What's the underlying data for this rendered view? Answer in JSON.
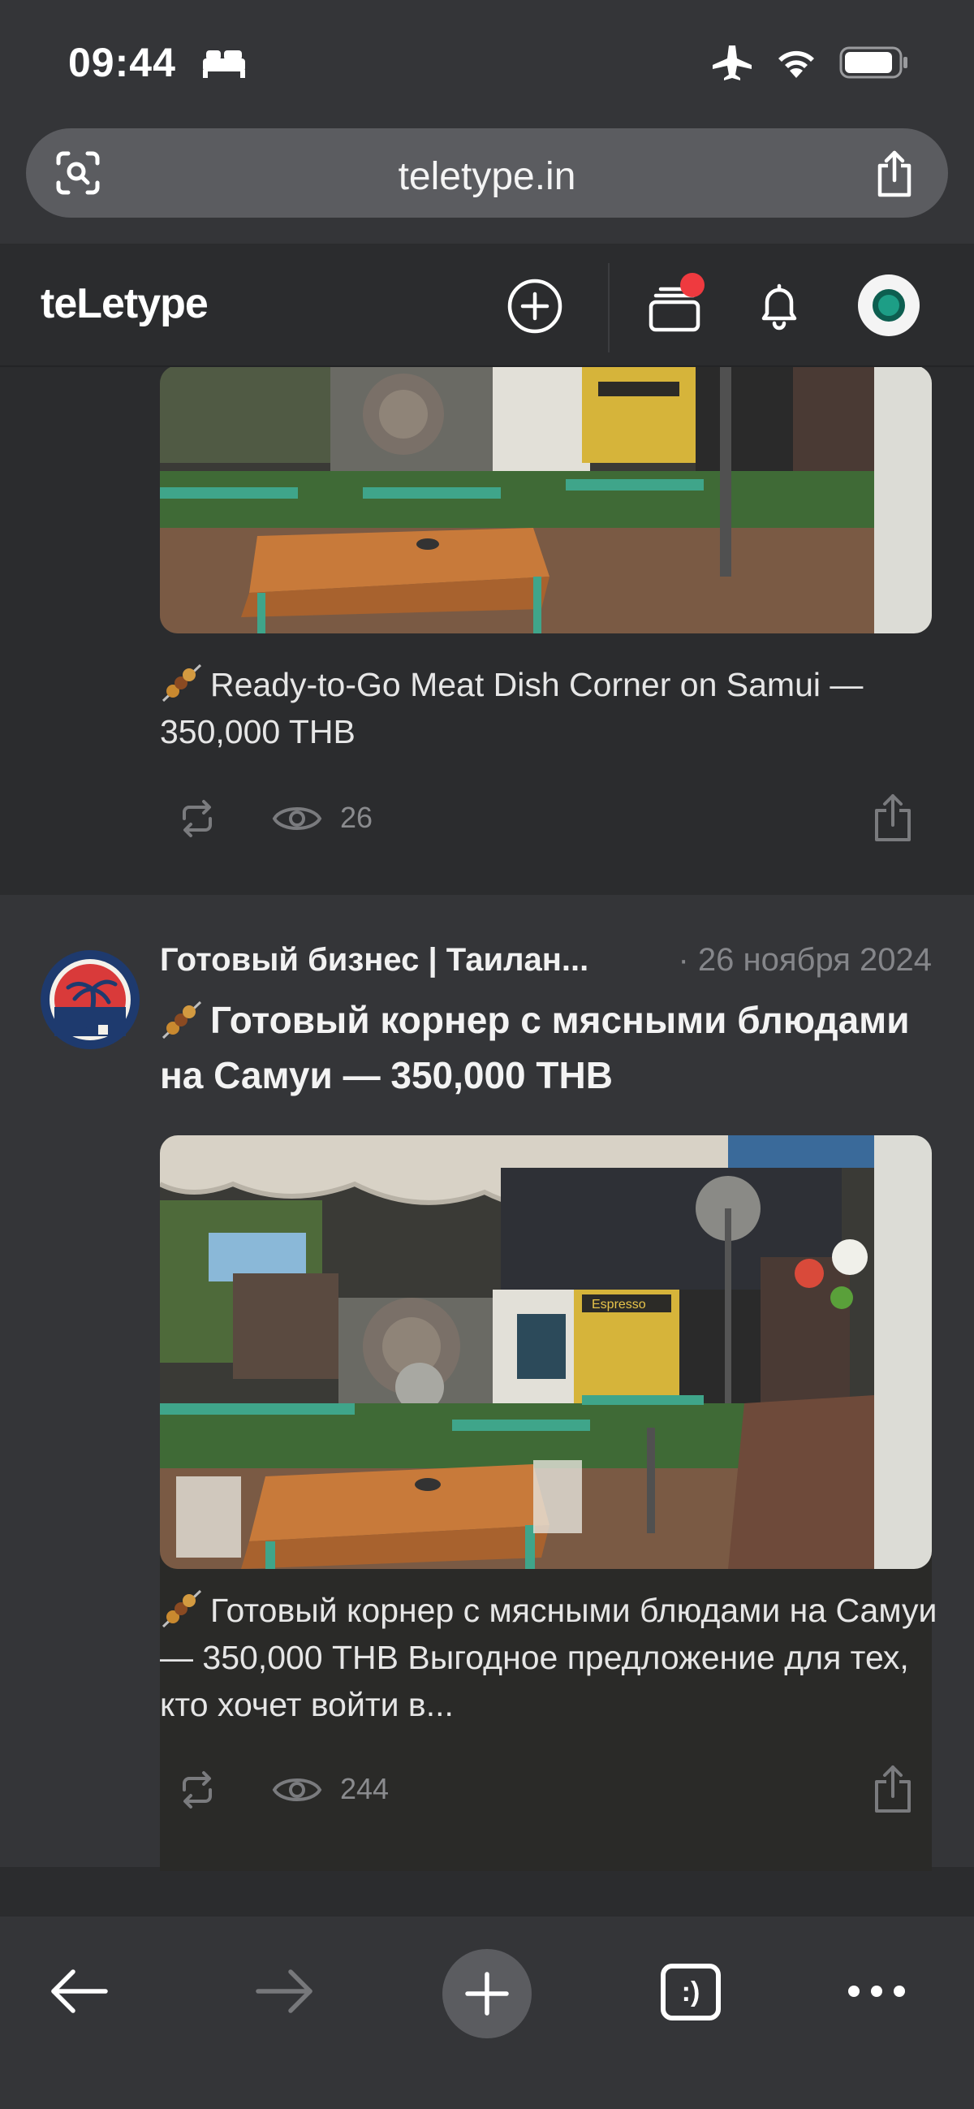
{
  "status_bar": {
    "time": "09:44"
  },
  "browser": {
    "url": "teletype.in"
  },
  "app_header": {
    "logo": "teLetype"
  },
  "posts": [
    {
      "excerpt": "Ready-to-Go Meat Dish Corner on Samui — 350,000 THB",
      "views": "26"
    },
    {
      "author": "Готовый бизнес | Таилан...",
      "date": "· 26 ноября 2024",
      "title": "Готовый корнер с мясными блюдами на Самуи — 350,000 THB",
      "excerpt": "Готовый корнер с мясными блюдами на Самуи — 350,000 THB Выгодное предложение для тех, кто хочет войти в...",
      "views": "244"
    }
  ],
  "photo_sign": "Espresso",
  "bottom_bar": {
    "tabs_label": ":)"
  },
  "colors": {
    "notification_dot": "#ef3a3f",
    "background": "#2b2c2e",
    "card_alt": "#343538"
  }
}
